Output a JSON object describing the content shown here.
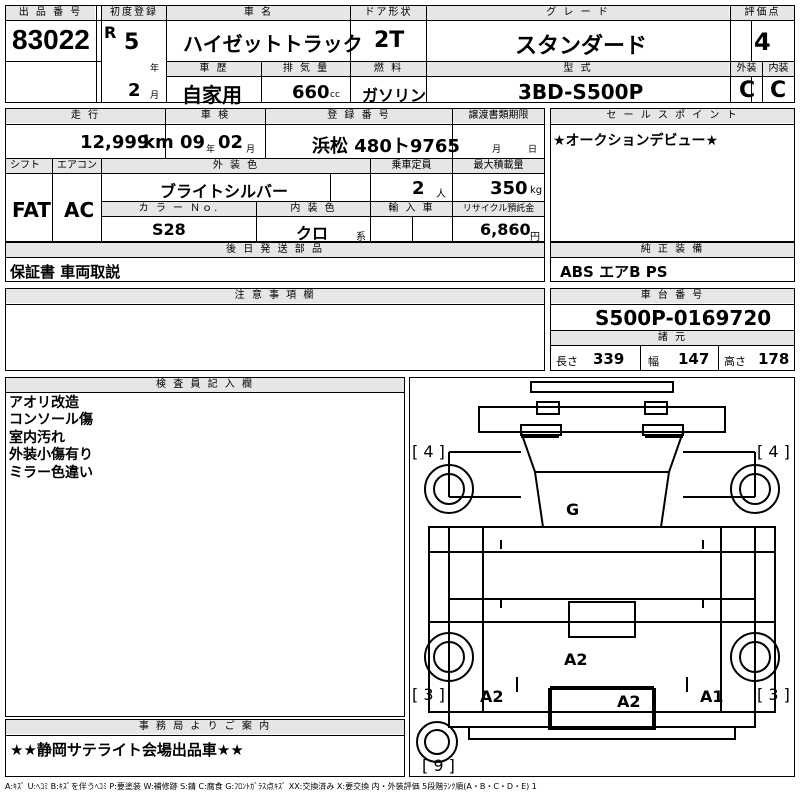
{
  "headers": {
    "lot_no": "出 品 番 号",
    "first_reg": "初度登録",
    "car_name": "車 名",
    "door": "ドア形状",
    "grade": "グ レ ー ド",
    "score": "評価点",
    "history": "車 歴",
    "displacement": "排 気 量",
    "fuel": "燃 料",
    "model": "型 式",
    "exterior": "外装",
    "interior": "内装",
    "mileage": "走 行",
    "inspection": "車 検",
    "plate": "登 録 番 号",
    "transfer_doc": "譲渡書類期限",
    "sales_point": "セ ー ル ス ポ イ ン ト",
    "shift": "シフト",
    "aircon": "エアコン",
    "ext_color": "外 装 色",
    "capacity": "乗車定員",
    "max_load": "最大積載量",
    "color_no": "カ ラ ー Ｎｏ.",
    "int_color": "内 装 色",
    "import": "輸 入 車",
    "recycle": "リサイクル預託金",
    "later_parts": "後 日 発 送 部 品",
    "genuine": "純 正 装 備",
    "caution": "注 意 事 項 欄",
    "chassis_no": "車 台 番 号",
    "dimensions": "諸 元",
    "inspector": "検 査 員 記 入 欄",
    "office": "事 務 局 よ り ご 案 内"
  },
  "vehicle": {
    "lot_no": "83022",
    "era": "R",
    "year": "5",
    "year_unit": "年",
    "month": "2",
    "month_unit": "月",
    "car_name": "ハイゼットトラック",
    "door": "2T",
    "grade": "スタンダード",
    "score": "4",
    "history": "自家用",
    "displacement": "660",
    "displacement_unit": "cc",
    "fuel": "ガソリン",
    "model": "3BD-S500P",
    "exterior_grade": "C",
    "interior_grade": "C",
    "mileage": "12,999",
    "mileage_unit": "km",
    "inspection_year": "09",
    "inspection_year_unit": "年",
    "inspection_month": "02",
    "inspection_month_unit": "月",
    "plate": "浜松 480ト9765",
    "transfer_month_unit": "月",
    "transfer_day_unit": "日",
    "sales_point": "★オークションデビュー★",
    "shift": "FAT",
    "aircon": "AC",
    "ext_color": "ブライトシルバー",
    "capacity": "2",
    "capacity_unit": "人",
    "max_load": "350",
    "max_load_unit": "kg",
    "color_no": "S28",
    "int_color": "クロ",
    "int_color_unit": "系",
    "recycle": "6,860",
    "recycle_unit": "円",
    "later_parts": "保証書 車両取説",
    "genuine": "ABS エアB PS",
    "chassis_no": "S500P-0169720",
    "length_label": "長さ",
    "length": "339",
    "width_label": "幅",
    "width": "147",
    "height_label": "高さ",
    "height": "178"
  },
  "inspector_notes": [
    "アオリ改造",
    "コンソール傷",
    "室内汚れ",
    "外装小傷有り",
    "ミラー色違い"
  ],
  "office_note": "★★静岡サテライト会場出品車★★",
  "diagram": {
    "tire_fl": "[ 4 ]",
    "tire_fr": "[ 4 ]",
    "tire_rl": "[ 3 ]",
    "tire_rr": "[ 3 ]",
    "tire_spare": "[ 9 ]",
    "mark_bed": "G",
    "mark_center": "A2",
    "mark_left": "A2",
    "mark_rear": "A2",
    "mark_right": "A1"
  },
  "legend": "A:ｷｽﾞ U:ﾍｺﾐ B:ｷｽﾞを伴うﾍｺﾐ P:要塗装 W:補修跡 S:錆 C:腐食 G:ﾌﾛﾝﾄｶﾞﾗｽ点ｷｽﾞ XX:交換済み X:要交換 内・外装評価 5段階ﾗﾝｸ順(A・B・C・D・E) 1"
}
